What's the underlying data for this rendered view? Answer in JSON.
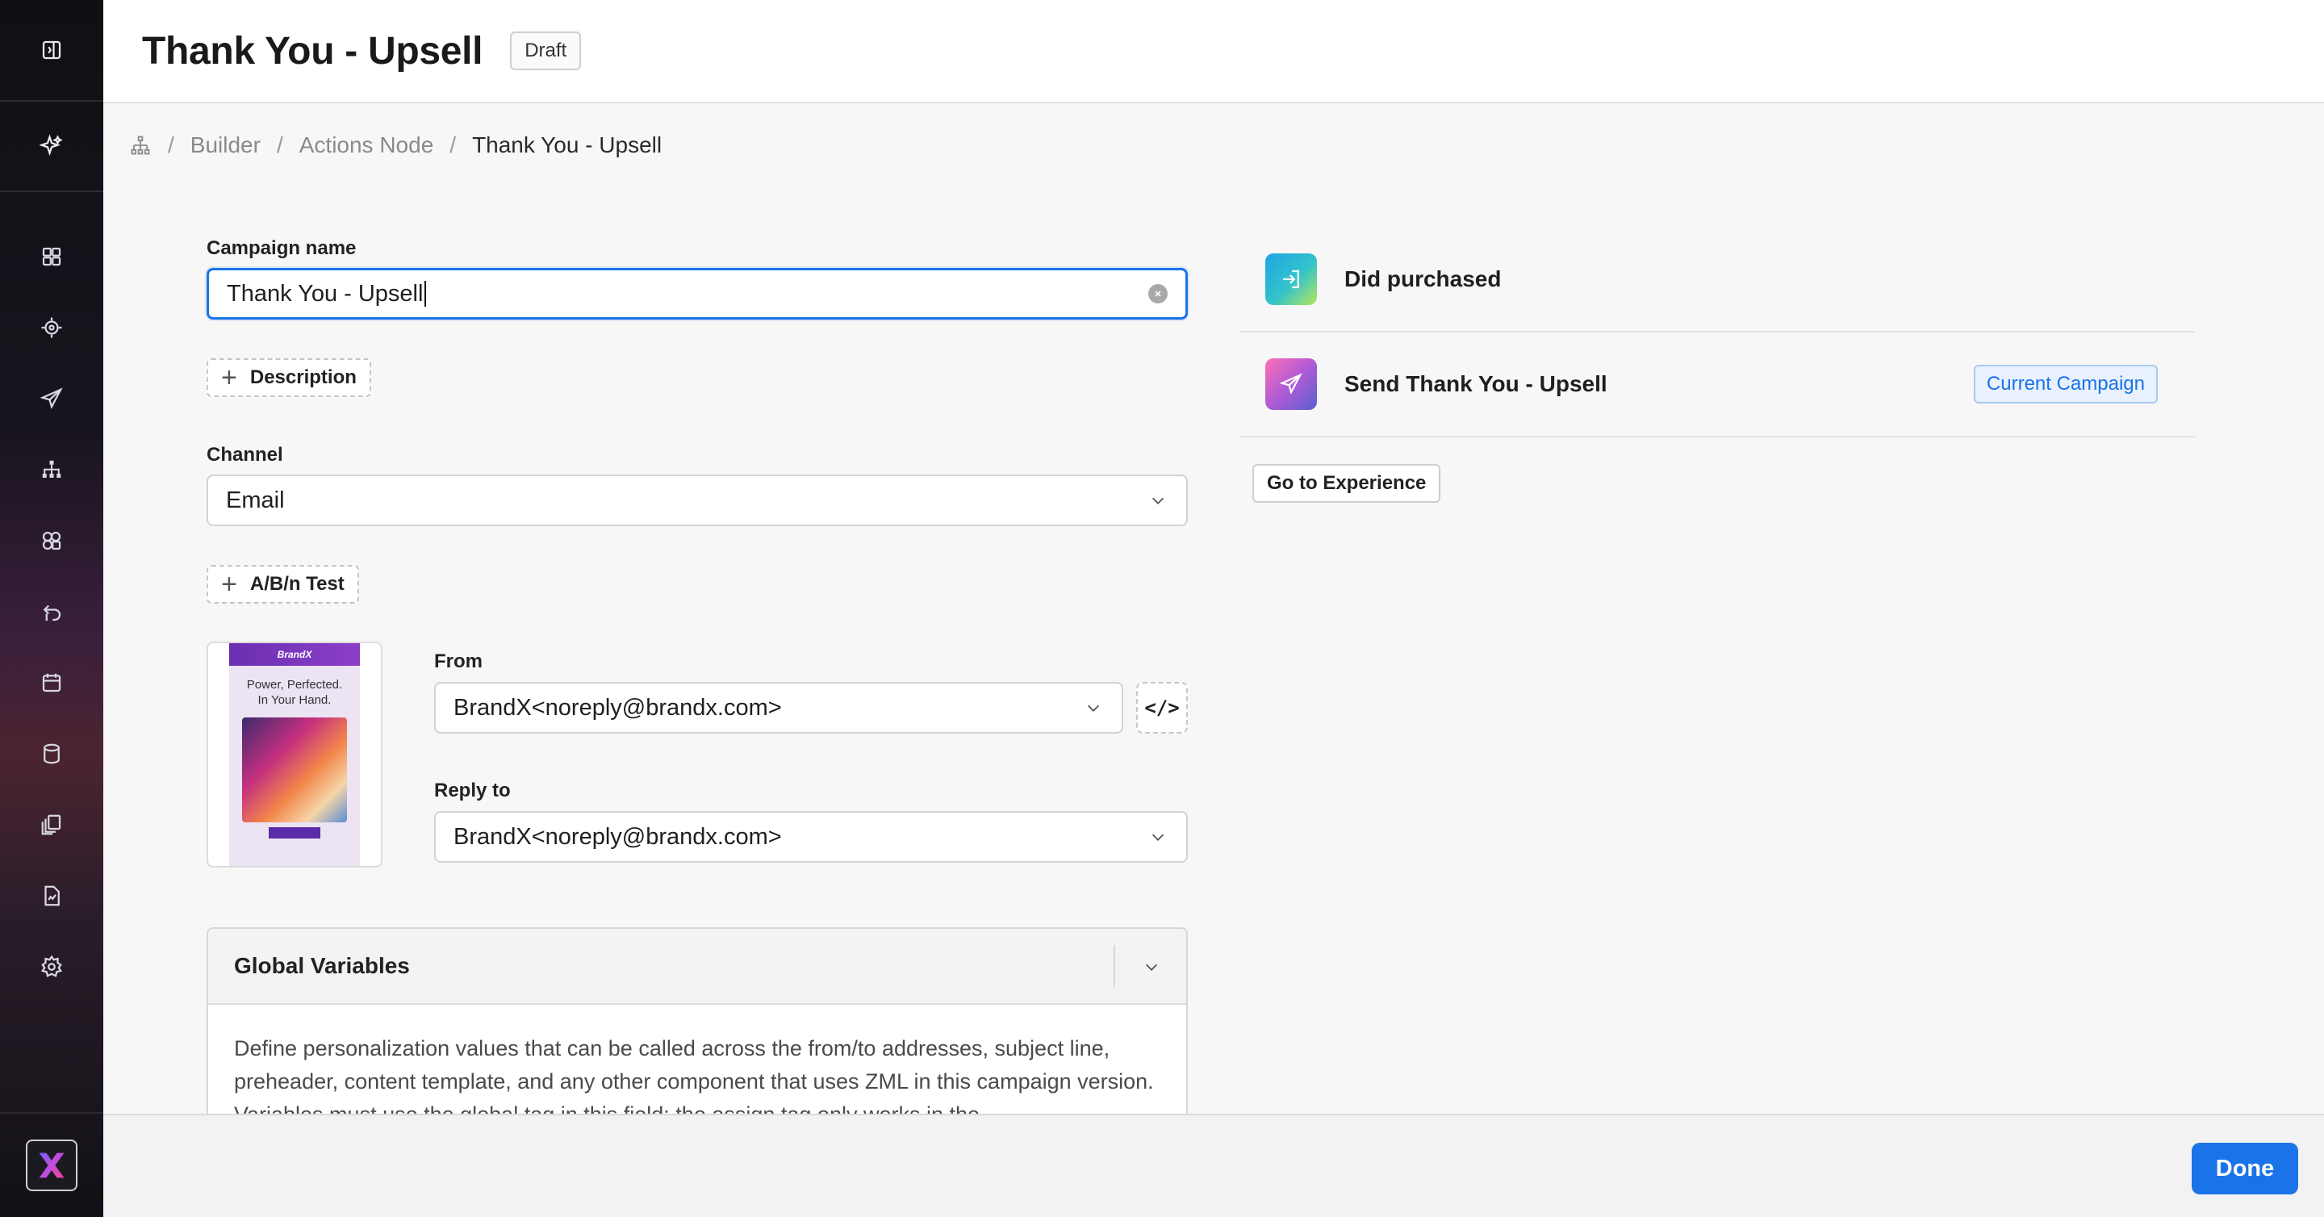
{
  "header": {
    "title": "Thank You - Upsell",
    "status_badge": "Draft"
  },
  "breadcrumb": {
    "icon": "journey-tree-icon",
    "items": [
      "Builder",
      "Actions Node"
    ],
    "current": "Thank You - Upsell"
  },
  "sidebar": {
    "toggle_icon": "sidebar-collapse-icon",
    "ai_icon": "sparkle-icon",
    "items": [
      {
        "icon": "dashboard-grid-icon"
      },
      {
        "icon": "target-icon"
      },
      {
        "icon": "send-icon"
      },
      {
        "icon": "journey-tree-icon"
      },
      {
        "icon": "segments-icon"
      },
      {
        "icon": "return-arrow-icon"
      },
      {
        "icon": "calendar-icon"
      },
      {
        "icon": "database-icon"
      },
      {
        "icon": "content-library-icon"
      },
      {
        "icon": "report-icon"
      },
      {
        "icon": "settings-gear-icon"
      }
    ],
    "logo_icon": "brand-x-logo"
  },
  "form": {
    "campaign_name_label": "Campaign name",
    "campaign_name_value": "Thank You - Upsell",
    "description_button": "Description",
    "channel_label": "Channel",
    "channel_value": "Email",
    "ab_test_button": "A/B/n Test",
    "from_label": "From",
    "from_value": "BrandX<noreply@brandx.com>",
    "reply_to_label": "Reply to",
    "reply_to_value": "BrandX<noreply@brandx.com>",
    "code_button": "</>"
  },
  "preview": {
    "brand": "BrandX",
    "headline_line1": "Power, Perfected.",
    "headline_line2": "In Your Hand."
  },
  "global_variables": {
    "title": "Global Variables",
    "description": "Define personalization values that can be called across the from/to addresses, subject line, preheader, content template, and any other component that uses ZML in this campaign version. Variables must use the global tag in this field: the assign tag only works in the"
  },
  "flow": {
    "steps": [
      {
        "label": "Did purchased",
        "icon": "enter-arrow-icon"
      },
      {
        "label": "Send Thank You - Upsell",
        "icon": "send-icon",
        "badge": "Current Campaign"
      }
    ],
    "goto_button": "Go to Experience"
  },
  "footer": {
    "done_button": "Done"
  },
  "colors": {
    "accent": "#1a73e8",
    "sidebar_bg": "#101014"
  }
}
